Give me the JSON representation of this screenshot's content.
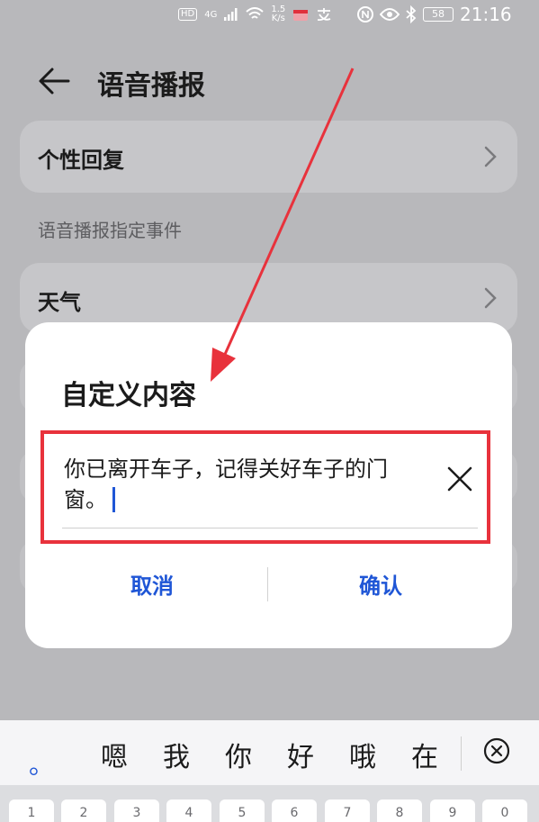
{
  "status_bar": {
    "hd": "HD",
    "network": "4G",
    "speed_value": "1.5",
    "speed_unit": "K/s",
    "battery": "58",
    "time": "21:16"
  },
  "header": {
    "title": "语音播报"
  },
  "settings": {
    "personal_reply": "个性回复",
    "section_label": "语音播报指定事件",
    "weather": "天气"
  },
  "dialog": {
    "title": "自定义内容",
    "input_value": "你已离开车子，记得关好车子的门窗。",
    "cancel_label": "取消",
    "confirm_label": "确认"
  },
  "keyboard": {
    "punct": "。",
    "candidates": [
      "嗯",
      "我",
      "你",
      "好",
      "哦",
      "在"
    ],
    "number_keys": [
      "1",
      "2",
      "3",
      "4",
      "5",
      "6",
      "7",
      "8",
      "9",
      "0"
    ]
  },
  "colors": {
    "accent": "#1f56d6",
    "highlight": "#e8323c"
  }
}
